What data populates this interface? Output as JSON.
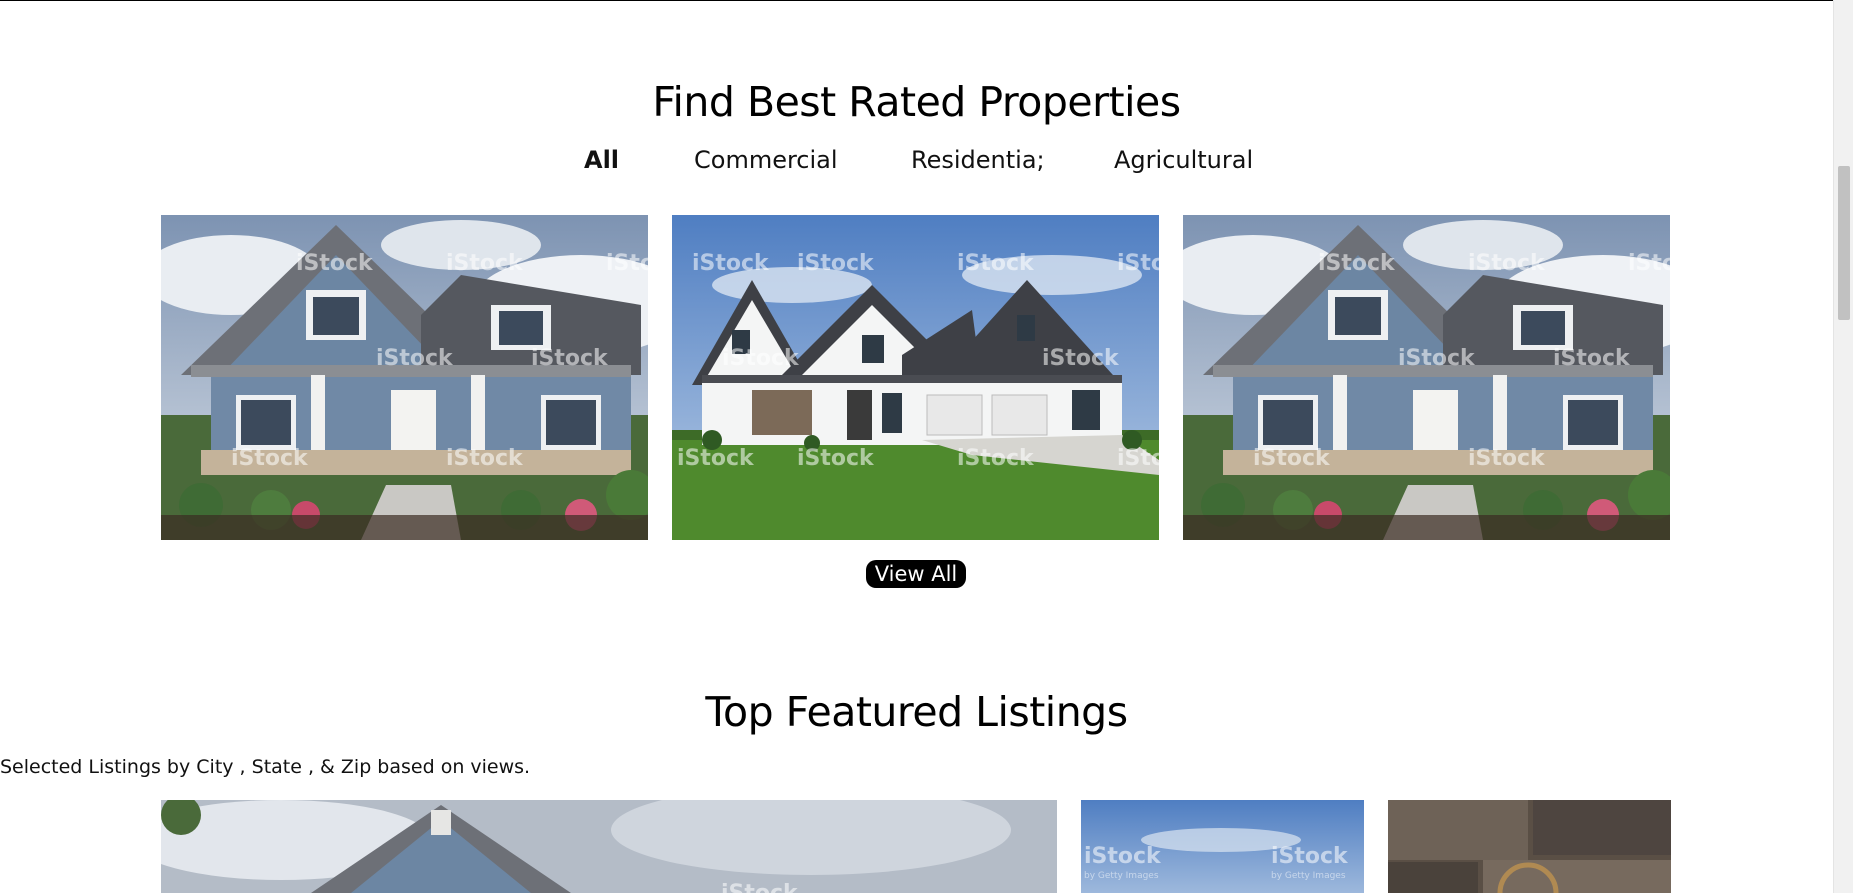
{
  "section1": {
    "title": "Find Best Rated Properties",
    "tabs": [
      {
        "label": "All",
        "active": true
      },
      {
        "label": "Commercial",
        "active": false
      },
      {
        "label": "Residentia;",
        "active": false
      },
      {
        "label": "Agricultural",
        "active": false
      }
    ],
    "cards": [
      {
        "image": "blue-craftsman-house-photo"
      },
      {
        "image": "white-farmhouse-photo"
      },
      {
        "image": "blue-craftsman-house-photo"
      }
    ],
    "view_all_label": "View All",
    "watermark": "iStock",
    "watermark_sub": "by Getty Images"
  },
  "section2": {
    "title": "Top Featured Listings",
    "subtitle": "Selected Listings by City , State , & Zip based on views.",
    "cards": [
      {
        "image": "blue-craftsman-house-photo"
      },
      {
        "image": "sky-photo"
      },
      {
        "image": "interior-stone-wall-photo"
      }
    ]
  },
  "colors": {
    "accent": "#000000",
    "button_text": "#ffffff"
  }
}
